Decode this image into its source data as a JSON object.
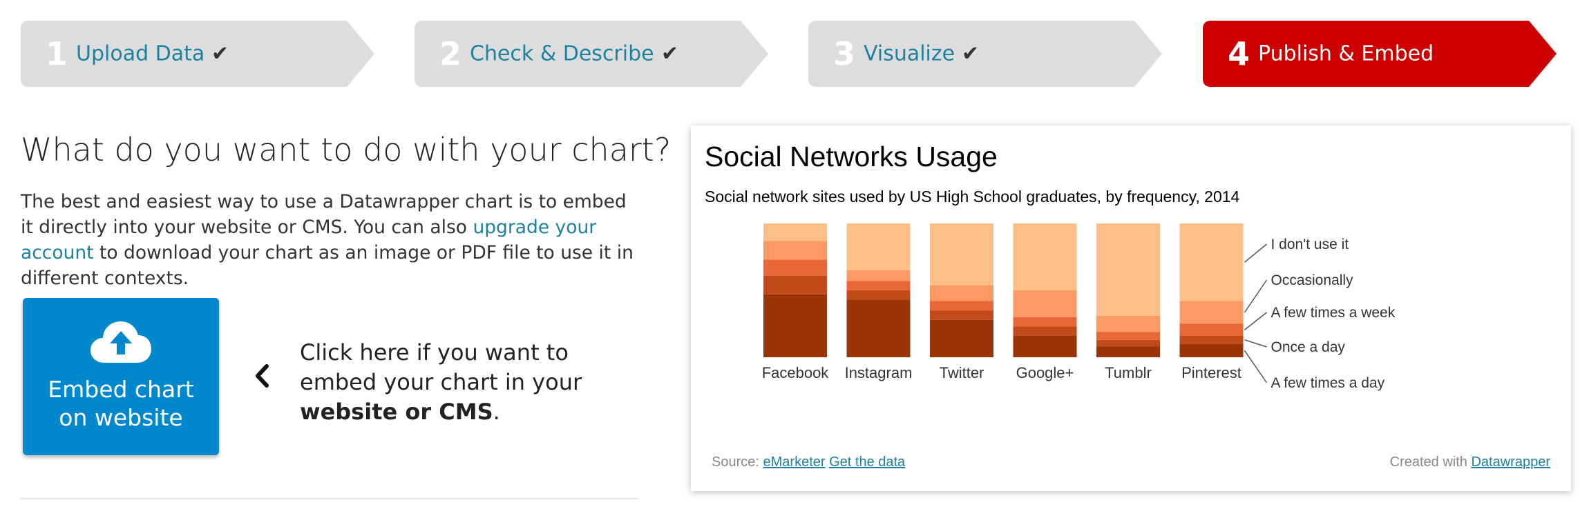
{
  "steps": [
    {
      "num": "1",
      "label": "Upload Data",
      "done": true,
      "active": false
    },
    {
      "num": "2",
      "label": "Check & Describe",
      "done": true,
      "active": false
    },
    {
      "num": "3",
      "label": "Visualize",
      "done": true,
      "active": false
    },
    {
      "num": "4",
      "label": "Publish & Embed",
      "done": false,
      "active": true
    }
  ],
  "check_glyph": "✔",
  "colors": {
    "step_inactive": "#dddddd",
    "step_active": "#cc0000",
    "link": "#1d81a2",
    "embed_button": "#0188cc"
  },
  "main": {
    "heading": "What do you want to do with your chart?",
    "intro_before": "The best and easiest way to use a Datawrapper chart is to embed it directly into your website or CMS. You can also ",
    "intro_link": "upgrade your account",
    "intro_after": " to download your chart as an image or PDF file to use it in different contexts.",
    "embed_button_line1": "Embed chart",
    "embed_button_line2": "on website",
    "embed_button_icon": "cloud-upload-icon",
    "hint_before": "Click here if you want to embed your chart in your ",
    "hint_bold": "website or CMS",
    "hint_after": "."
  },
  "chart_panel": {
    "source_label": "Source:",
    "source_link": "eMarketer",
    "get_data": "Get the data",
    "created_with": "Created with",
    "created_link": "Datawrapper"
  },
  "chart_data": {
    "type": "bar",
    "stacked": true,
    "title": "Social Networks Usage",
    "subtitle": "Social network sites used by US High School graduates, by frequency, 2014",
    "categories": [
      "Facebook",
      "Instagram",
      "Twitter",
      "Google+",
      "Tumblr",
      "Pinterest"
    ],
    "ylim": [
      0,
      100
    ],
    "series": [
      {
        "name": "A few times a day",
        "color": "#993404",
        "values": [
          47,
          43,
          28,
          16,
          8,
          10
        ]
      },
      {
        "name": "Once a day",
        "color": "#c14a1a",
        "values": [
          14,
          7,
          7,
          7,
          5,
          6
        ]
      },
      {
        "name": "A few times a week",
        "color": "#e8683a",
        "values": [
          12,
          7,
          7,
          7,
          6,
          9
        ]
      },
      {
        "name": "Occasionally",
        "color": "#fc9a66",
        "values": [
          14,
          8,
          12,
          20,
          12,
          17
        ]
      },
      {
        "name": "I don't use it",
        "color": "#fdbf88",
        "values": [
          13,
          35,
          46,
          50,
          69,
          58
        ]
      }
    ],
    "legend": "right, labels attached to last bar"
  }
}
